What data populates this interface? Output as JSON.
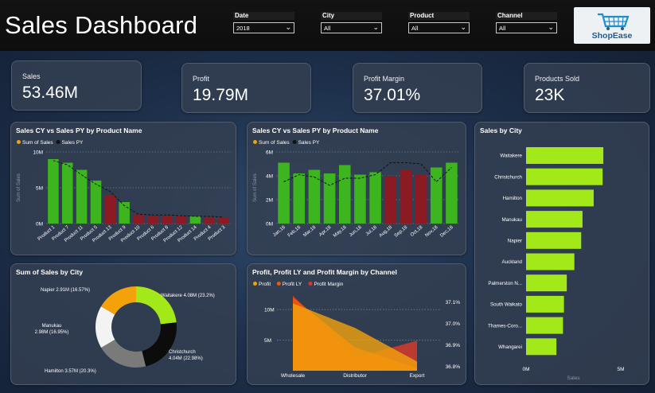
{
  "header": {
    "title": "Sales Dashboard"
  },
  "filters": [
    {
      "label": "Date",
      "value": "2018"
    },
    {
      "label": "City",
      "value": "All"
    },
    {
      "label": "Product",
      "value": "All"
    },
    {
      "label": "Channel",
      "value": "All"
    }
  ],
  "logo": {
    "text": "ShopEase",
    "icon": "shopping-cart-icon"
  },
  "kpis": [
    {
      "label": "Sales",
      "value": "53.46M"
    },
    {
      "label": "Profit",
      "value": "19.79M"
    },
    {
      "label": "Profit Margin",
      "value": "37.01%"
    },
    {
      "label": "Products Sold",
      "value": "23K"
    }
  ],
  "colors": {
    "cy": "#3cb51e",
    "py": "#8b1a22",
    "bar_city": "#a3e819",
    "donut": [
      "#a3e819",
      "#0c0c0c",
      "#7a7a7a",
      "#f3f3f3",
      "#f4a20c"
    ],
    "area_profit": "#f4a20c",
    "area_profitly": "#ef5a0a",
    "area_margin": "#d33a2c"
  },
  "chart_data": [
    {
      "id": "product",
      "type": "bar",
      "title": "Sales CY vs Sales PY by Product Name",
      "legend": [
        "Sum of Sales",
        "Sales PY"
      ],
      "ylabel": "Sum of Sales",
      "yticks": [
        "0M",
        "5M",
        "10M"
      ],
      "ylim": [
        0,
        10
      ],
      "categories": [
        "Product 1",
        "Product 7",
        "Product 11",
        "Product 5",
        "Product 13",
        "Product 9",
        "Product 10",
        "Product 6",
        "Product 8",
        "Product 12",
        "Product 14",
        "Product 4",
        "Product 3"
      ],
      "series": [
        {
          "name": "Sum of Sales",
          "values": [
            9.0,
            8.5,
            7.5,
            6.0,
            4.0,
            3.0,
            1.2,
            1.1,
            1.1,
            1.0,
            1.0,
            0.9,
            0.8
          ]
        },
        {
          "name": "Sales PY",
          "values": [
            8.8,
            8.2,
            6.8,
            5.5,
            4.5,
            2.5,
            1.3,
            1.2,
            1.2,
            1.1,
            1.0,
            1.0,
            0.9
          ]
        }
      ],
      "legend_position": "top-left"
    },
    {
      "id": "month",
      "type": "bar",
      "title": "Sales CY vs Sales PY by Product Name",
      "legend": [
        "Sum of Sales",
        "Sales PY"
      ],
      "ylabel": "Sum of Sales",
      "yticks": [
        "0M",
        "2M",
        "4M",
        "6M"
      ],
      "ylim": [
        0,
        6
      ],
      "categories": [
        "Jan,18",
        "Feb,18",
        "Mar,18",
        "Apr,18",
        "May,18",
        "Jun,18",
        "Jul,18",
        "Aug,18",
        "Sep,18",
        "Oct,18",
        "Nov,18",
        "Dec,18"
      ],
      "series": [
        {
          "name": "Sum of Sales",
          "values": [
            5.1,
            4.2,
            4.5,
            4.2,
            4.9,
            4.1,
            4.3,
            4.0,
            4.5,
            4.1,
            4.7,
            5.1
          ]
        },
        {
          "name": "Sales PY",
          "values": [
            3.5,
            4.1,
            3.9,
            3.2,
            3.8,
            3.8,
            4.1,
            5.1,
            5.1,
            5.0,
            3.5,
            4.7
          ]
        }
      ],
      "legend_position": "top-left"
    },
    {
      "id": "donut",
      "type": "pie",
      "title": "Sum of Sales by City",
      "labels": [
        "Waitakere 4.08M (23.2%)",
        "Christchurch 4.04M (22.98%)",
        "Hamilton 3.57M (20.3%)",
        "Manukau 2.98M (16.95%)",
        "Napier 2.91M (16.57%)"
      ],
      "values": [
        23.2,
        22.98,
        20.3,
        16.95,
        16.57
      ]
    },
    {
      "id": "channel",
      "type": "area",
      "title": "Profit, Profit LY and Profit Margin by Channel",
      "legend": [
        "Profit",
        "Profit LY",
        "Profit Margin"
      ],
      "categories": [
        "Wholesale",
        "Distributor",
        "Export"
      ],
      "yticks_left": [
        "5M",
        "10M"
      ],
      "yticks_right": [
        "36.8%",
        "36.9%",
        "37.0%",
        "37.1%"
      ],
      "ylim": [
        0,
        13
      ],
      "ylim_right": [
        36.78,
        37.15
      ],
      "series": [
        {
          "name": "Profit",
          "values": [
            11.0,
            7.0,
            1.5
          ]
        },
        {
          "name": "Profit LY",
          "values": [
            12.0,
            3.8,
            0.4
          ]
        },
        {
          "name": "Profit Margin",
          "values": [
            37.13,
            36.84,
            36.92
          ]
        }
      ],
      "legend_position": "top-left"
    },
    {
      "id": "city",
      "type": "bar",
      "title": "Sales by City",
      "orientation": "horizontal",
      "xlabel": "Sales",
      "xticks": [
        "0M",
        "5M"
      ],
      "xlim": [
        0,
        5
      ],
      "categories": [
        "Waitakere",
        "Christchurch",
        "Hamilton",
        "Manukau",
        "Napier",
        "Auckland",
        "Palmerston N...",
        "South Waikato",
        "Thames-Coro...",
        "Whangarei"
      ],
      "values": [
        4.08,
        4.04,
        3.57,
        2.98,
        2.91,
        2.55,
        2.15,
        2.0,
        1.95,
        1.6
      ]
    }
  ]
}
